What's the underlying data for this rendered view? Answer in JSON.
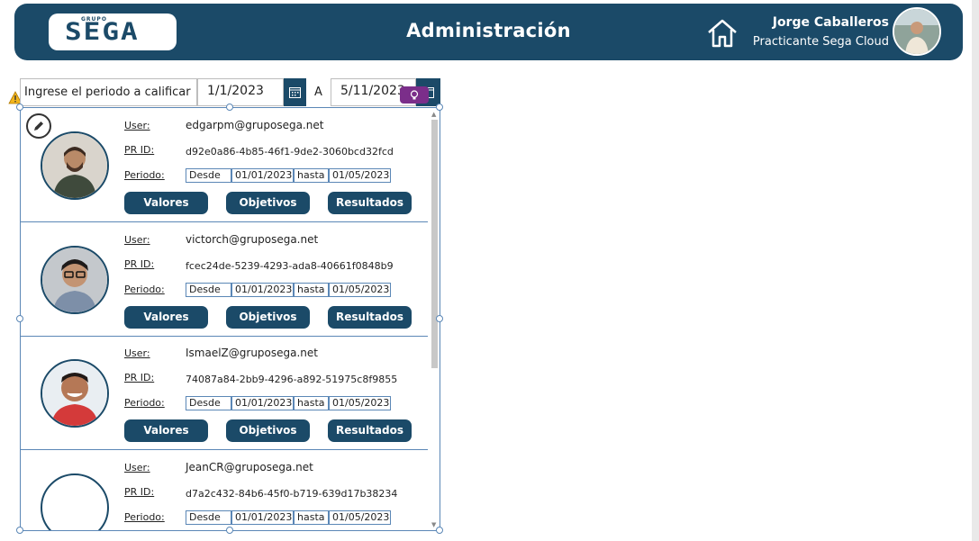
{
  "header": {
    "logo_small": "GRUPO",
    "logo_text": "SEGA",
    "title": "Administración",
    "user_name": "Jorge Caballeros",
    "user_role": "Practicante Sega Cloud"
  },
  "filter": {
    "label": "Ingrese el periodo a calificar",
    "from_date": "1/1/2023",
    "separator": "A",
    "to_date": "5/11/2023"
  },
  "card_labels": {
    "user": "User:",
    "pr_id": "PR ID:",
    "periodo": "Periodo:",
    "desde": "Desde",
    "hasta": "hasta"
  },
  "buttons": {
    "valores": "Valores",
    "objetivos": "Objetivos",
    "resultados": "Resultados"
  },
  "records": [
    {
      "user": "edgarpm@gruposega.net",
      "pr_id": "d92e0a86-4b85-46f1-9de2-3060bcd32fcd",
      "desde": "01/01/2023",
      "hasta": "01/05/2023"
    },
    {
      "user": "victorch@gruposega.net",
      "pr_id": "fcec24de-5239-4293-ada8-40661f0848b9",
      "desde": "01/01/2023",
      "hasta": "01/05/2023"
    },
    {
      "user": "IsmaelZ@gruposega.net",
      "pr_id": "74087a84-2bb9-4296-a892-51975c8f9855",
      "desde": "01/01/2023",
      "hasta": "01/05/2023"
    },
    {
      "user": "JeanCR@gruposega.net",
      "pr_id": "d7a2c432-84b6-45f0-b719-639d17b38234",
      "desde": "01/01/2023",
      "hasta": "01/05/2023"
    }
  ],
  "colors": {
    "primary": "#1b4a68",
    "selection": "#5b87b6",
    "idea_badge": "#7b2e8a",
    "warning": "#f2b51c"
  },
  "icons": {
    "home": "home-icon",
    "calendar": "calendar-icon",
    "edit": "pencil-icon",
    "warning": "warning-icon",
    "idea": "lightbulb-icon"
  }
}
